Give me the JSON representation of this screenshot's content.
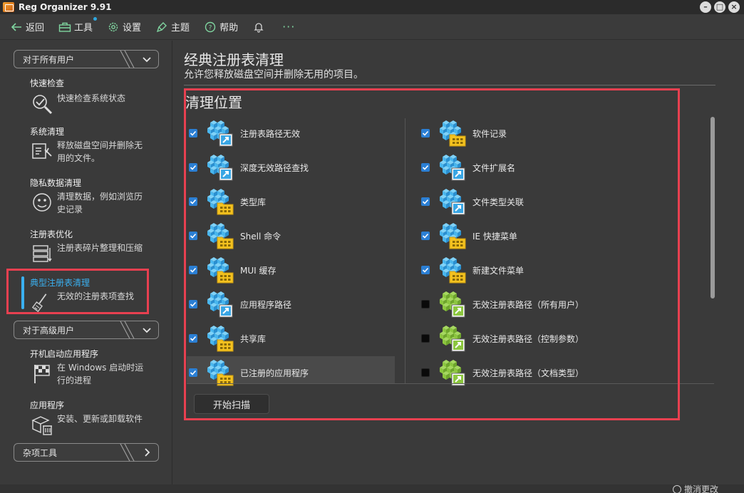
{
  "window": {
    "title": "Reg Organizer 9.91"
  },
  "toolbar": {
    "back": "返回",
    "tools": "工具",
    "settings": "设置",
    "theme": "主题",
    "help": "帮助",
    "more": "···"
  },
  "sidebar": {
    "group_all_users": "对于所有用户",
    "group_advanced": "对于高级用户",
    "group_misc": "杂项工具",
    "items": [
      {
        "title": "快速检查",
        "desc": "快速检查系统状态",
        "icon": "quick-check-icon"
      },
      {
        "title": "系统清理",
        "desc": "释放磁盘空间并删除无用的文件。",
        "icon": "system-cleanup-icon"
      },
      {
        "title": "隐私数据清理",
        "desc": "清理数据，例如浏览历史记录",
        "icon": "privacy-icon"
      },
      {
        "title": "注册表优化",
        "desc": "注册表碎片整理和压缩",
        "icon": "registry-optimize-icon"
      },
      {
        "title": "典型注册表清理",
        "desc": "无效的注册表项查找",
        "icon": "registry-clean-icon",
        "active": true
      },
      {
        "title": "开机启动应用程序",
        "desc": "在 Windows 启动时运行的进程",
        "icon": "startup-icon"
      },
      {
        "title": "应用程序",
        "desc": "安装、更新或卸载软件",
        "icon": "apps-icon"
      }
    ]
  },
  "main": {
    "title": "经典注册表清理",
    "subtitle": "允许您释放磁盘空间并删除无用的项目。",
    "section_title": "清理位置",
    "left_items": [
      {
        "label": "注册表路径无效",
        "checked": true,
        "icon": "registry-arrow-icon"
      },
      {
        "label": "深度无效路径查找",
        "checked": true,
        "icon": "registry-arrow-icon"
      },
      {
        "label": "类型库",
        "checked": true,
        "icon": "registry-folder-icon"
      },
      {
        "label": "Shell 命令",
        "checked": true,
        "icon": "registry-folder-icon"
      },
      {
        "label": "MUI 缓存",
        "checked": true,
        "icon": "registry-folder-icon"
      },
      {
        "label": "应用程序路径",
        "checked": true,
        "icon": "registry-arrow-icon"
      },
      {
        "label": "共享库",
        "checked": true,
        "icon": "registry-folder-icon"
      },
      {
        "label": "已注册的应用程序",
        "checked": true,
        "icon": "registry-folder-icon"
      }
    ],
    "right_items": [
      {
        "label": "软件记录",
        "checked": true,
        "icon": "registry-folder-icon"
      },
      {
        "label": "文件扩展名",
        "checked": true,
        "icon": "registry-arrow-icon"
      },
      {
        "label": "文件类型关联",
        "checked": true,
        "icon": "registry-arrow-icon"
      },
      {
        "label": "IE 快捷菜单",
        "checked": true,
        "icon": "registry-folder-icon"
      },
      {
        "label": "新建文件菜单",
        "checked": true,
        "icon": "registry-folder-icon"
      },
      {
        "label": "无效注册表路径（所有用户）",
        "checked": false,
        "icon": "registry-green-arrow-icon"
      },
      {
        "label": "无效注册表路径（控制参数）",
        "checked": false,
        "icon": "registry-green-arrow-icon"
      },
      {
        "label": "无效注册表路径（文档类型）",
        "checked": false,
        "icon": "registry-green-arrow-icon"
      }
    ],
    "scan_button": "开始扫描"
  },
  "status": {
    "undo": "撤消更改"
  },
  "colors": {
    "accent": "#3ab0f0",
    "highlight_border": "#e84050",
    "checkbox_on": "#2b7fd4",
    "background": "#3a3a3a"
  }
}
